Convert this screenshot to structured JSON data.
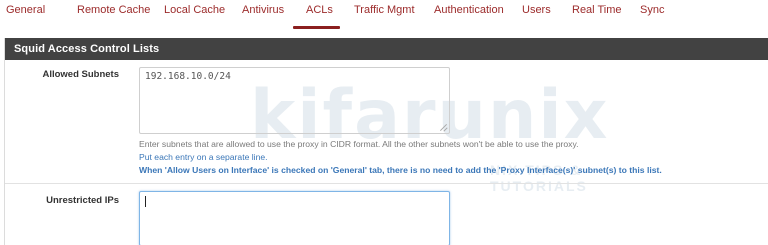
{
  "tabs": [
    {
      "label": "General"
    },
    {
      "label": "Remote Cache"
    },
    {
      "label": "Local Cache"
    },
    {
      "label": "Antivirus"
    },
    {
      "label": "ACLs",
      "active": true
    },
    {
      "label": "Traffic Mgmt"
    },
    {
      "label": "Authentication"
    },
    {
      "label": "Users"
    },
    {
      "label": "Real Time"
    },
    {
      "label": "Sync"
    }
  ],
  "panel": {
    "title": "Squid Access Control Lists",
    "allowed_subnets": {
      "label": "Allowed Subnets",
      "value": "192.168.10.0/24",
      "help_line1": "Enter subnets that are allowed to use the proxy in CIDR format. All the other subnets won't be able to use the proxy.",
      "help_line2": "Put each entry on a separate line.",
      "help_line3": "When 'Allow Users on Interface' is checked on 'General' tab, there is no need to add the 'Proxy Interface(s)' subnet(s) to this list."
    },
    "unrestricted_ips": {
      "label": "Unrestricted IPs",
      "value": ""
    }
  },
  "watermark": {
    "text": "kifarunix",
    "subtext": "NIX TIPS & TUTORIALS"
  },
  "colors": {
    "tab_text": "#9c2b2b",
    "tab_active_underline": "#8b1f1f",
    "panel_heading_bg": "#424242",
    "help_link": "#3b77b8"
  }
}
